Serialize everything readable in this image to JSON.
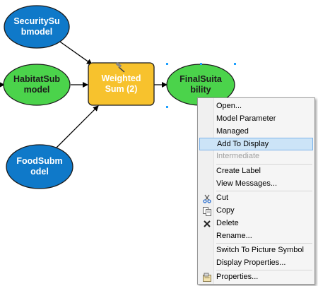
{
  "nodes": {
    "security": {
      "label": "SecuritySu\nbmodel",
      "color": "#0f79c9"
    },
    "habitat": {
      "label": "HabitatSub\nmodel",
      "color": "#4bd34b"
    },
    "food": {
      "label": "FoodSubm\nodel",
      "color": "#0f79c9"
    },
    "weighted": {
      "label": "Weighted\nSum (2)",
      "color": "#f7c22d"
    },
    "final": {
      "label": "FinalSuita\nbility",
      "color": "#4bd34b"
    }
  },
  "menu": {
    "items": [
      {
        "label": "Open...",
        "enabled": true
      },
      {
        "label": "Model Parameter",
        "enabled": true
      },
      {
        "label": "Managed",
        "enabled": true
      },
      {
        "label": "Add To Display",
        "enabled": true,
        "highlighted": true
      },
      {
        "label": "Intermediate",
        "enabled": false
      },
      {
        "label": "Create Label",
        "enabled": true
      },
      {
        "label": "View Messages...",
        "enabled": true
      },
      {
        "label": "Cut",
        "enabled": true,
        "icon": "scissors-icon"
      },
      {
        "label": "Copy",
        "enabled": true,
        "icon": "copy-icon"
      },
      {
        "label": "Delete",
        "enabled": true,
        "icon": "delete-icon"
      },
      {
        "label": "Rename...",
        "enabled": true
      },
      {
        "label": "Switch To Picture Symbol",
        "enabled": true
      },
      {
        "label": "Display Properties...",
        "enabled": true
      },
      {
        "label": "Properties...",
        "enabled": true,
        "icon": "properties-icon"
      }
    ]
  }
}
